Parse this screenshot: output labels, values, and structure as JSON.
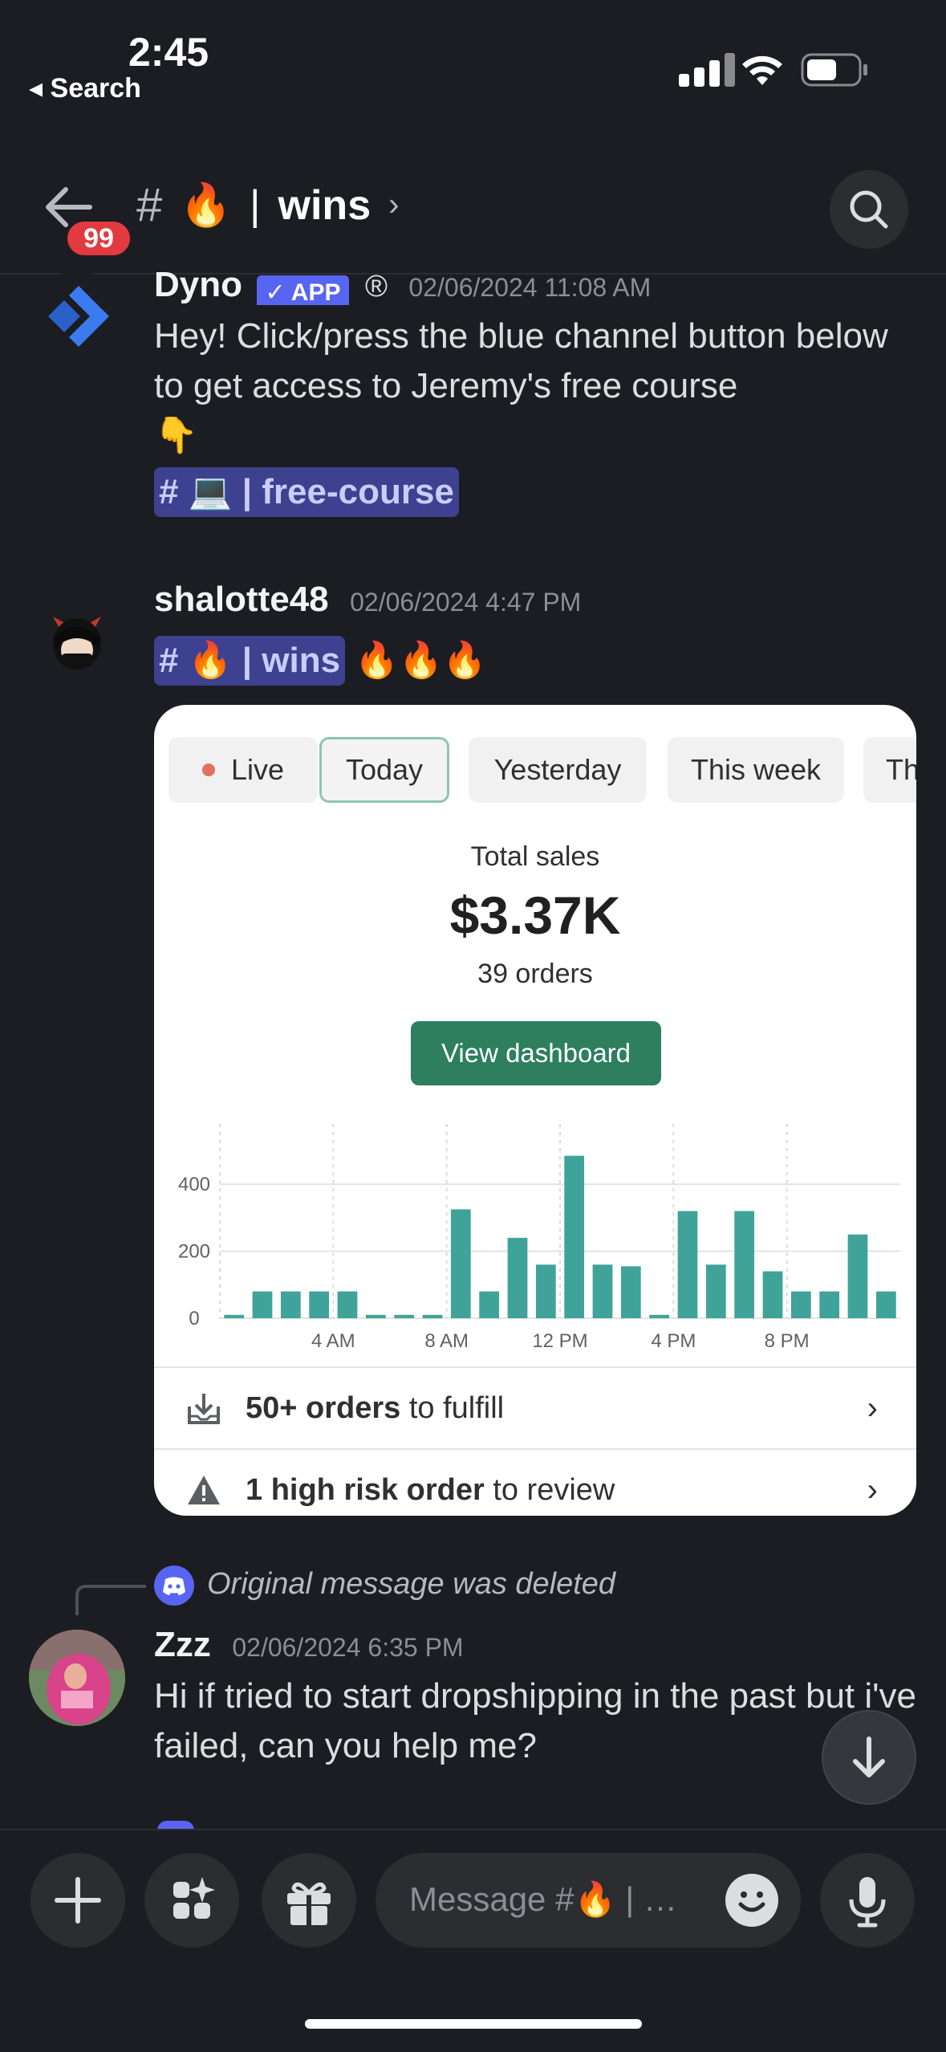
{
  "status_bar": {
    "time": "2:45",
    "back_label": "◂ Search"
  },
  "header": {
    "unread_badge": "99",
    "channel_emoji": "🔥",
    "channel_name": "wins",
    "separator": "|",
    "hash": "#",
    "chevron": "›"
  },
  "messages": [
    {
      "author": "Dyno",
      "app_tag": "✓ APP",
      "registered": "®",
      "timestamp": "02/06/2024 11:08 AM",
      "text": "Hey! Click/press the blue channel button below to get access to Jeremy's free course",
      "pointer_emoji": "👇",
      "channel_mention": "# 💻 | free-course"
    },
    {
      "author": "shalotte48",
      "timestamp": "02/06/2024 4:47 PM",
      "channel_mention": "# 🔥 | wins",
      "trailing_emojis": "🔥🔥🔥"
    },
    {
      "reply_note": "Original message was deleted",
      "author": "Zzz",
      "timestamp": "02/06/2024 6:35 PM",
      "text": "Hi if tried to start dropshipping in the past but i've failed, can you help me?"
    }
  ],
  "sales_card": {
    "tabs": [
      "Live",
      "Today",
      "Yesterday",
      "This week",
      "Th"
    ],
    "total_label": "Total sales",
    "total_value": "$3.37K",
    "orders": "39 orders",
    "button": "View dashboard",
    "row1_bold": "50+ orders",
    "row1_rest": " to fulfill",
    "row2_bold": "1 high risk order",
    "row2_rest": " to review",
    "bar_color": "#3fa39a"
  },
  "chart_data": {
    "type": "bar",
    "x": [
      "12 AM",
      "1 AM",
      "2 AM",
      "3 AM",
      "4 AM",
      "5 AM",
      "6 AM",
      "7 AM",
      "8 AM",
      "9 AM",
      "10 AM",
      "11 AM",
      "12 PM",
      "1 PM",
      "2 PM",
      "3 PM",
      "4 PM",
      "5 PM",
      "6 PM",
      "7 PM",
      "8 PM",
      "9 PM",
      "10 PM",
      "11 PM"
    ],
    "values": [
      10,
      80,
      80,
      80,
      80,
      10,
      10,
      10,
      325,
      80,
      240,
      160,
      485,
      160,
      155,
      10,
      320,
      160,
      320,
      140,
      80,
      80,
      250,
      80
    ],
    "y_ticks": [
      "0",
      "200",
      "400"
    ],
    "x_tick_labels": [
      "4 AM",
      "8 AM",
      "12 PM",
      "4 PM",
      "8 PM"
    ],
    "ylim": [
      0,
      580
    ]
  },
  "composer": {
    "placeholder": "Message #🔥 | …"
  }
}
